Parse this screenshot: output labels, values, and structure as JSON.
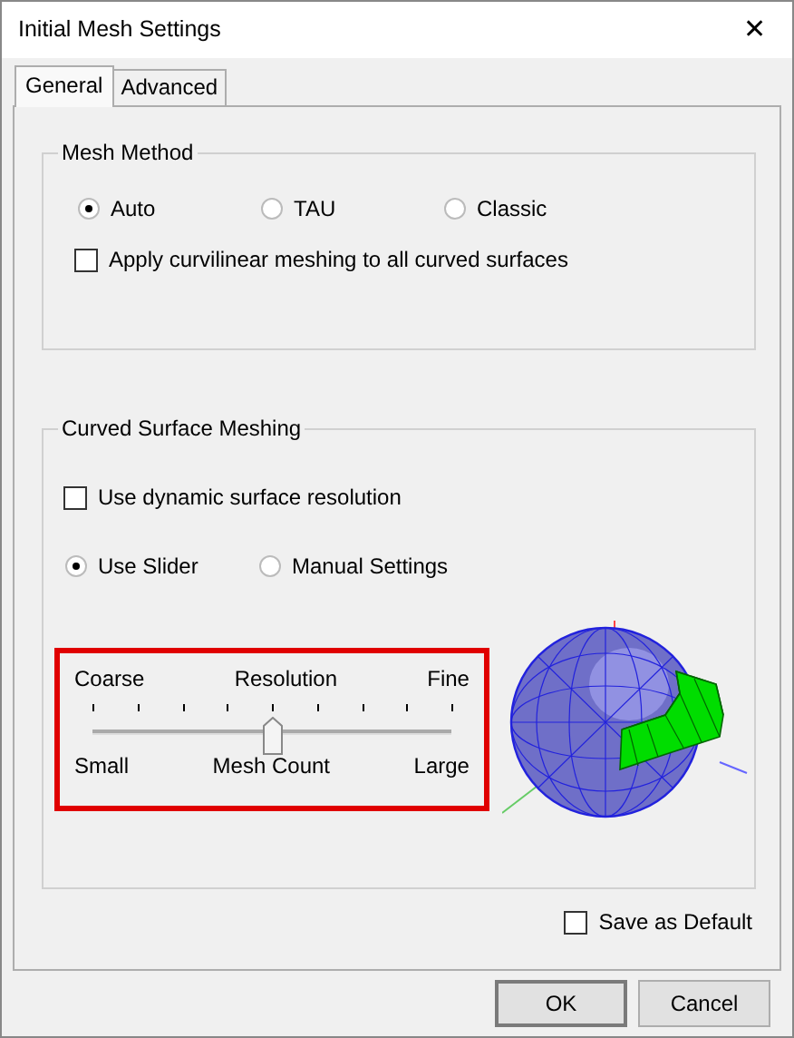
{
  "window": {
    "title": "Initial Mesh Settings",
    "close": "✕"
  },
  "tabs": [
    {
      "label": "General",
      "selected": true
    },
    {
      "label": "Advanced",
      "selected": false
    }
  ],
  "mesh_method": {
    "title": "Mesh Method",
    "options": [
      {
        "label": "Auto",
        "selected": true
      },
      {
        "label": "TAU",
        "selected": false
      },
      {
        "label": "Classic",
        "selected": false
      }
    ],
    "curvilinear": {
      "label": "Apply curvilinear meshing to all curved surfaces",
      "checked": false
    }
  },
  "curved_surface": {
    "title": "Curved Surface Meshing",
    "dynamic": {
      "label": "Use dynamic surface resolution",
      "checked": false
    },
    "modes": [
      {
        "label": "Use Slider",
        "selected": true
      },
      {
        "label": "Manual Settings",
        "selected": false
      }
    ],
    "slider": {
      "top_left": "Coarse",
      "top_center": "Resolution",
      "top_right": "Fine",
      "bottom_left": "Small",
      "bottom_center": "Mesh Count",
      "bottom_right": "Large",
      "level": 0.5,
      "highlighted": true
    }
  },
  "save_default": {
    "label": "Save as Default",
    "checked": false
  },
  "buttons": [
    {
      "label": "OK",
      "default": true
    },
    {
      "label": "Cancel",
      "default": false
    }
  ]
}
